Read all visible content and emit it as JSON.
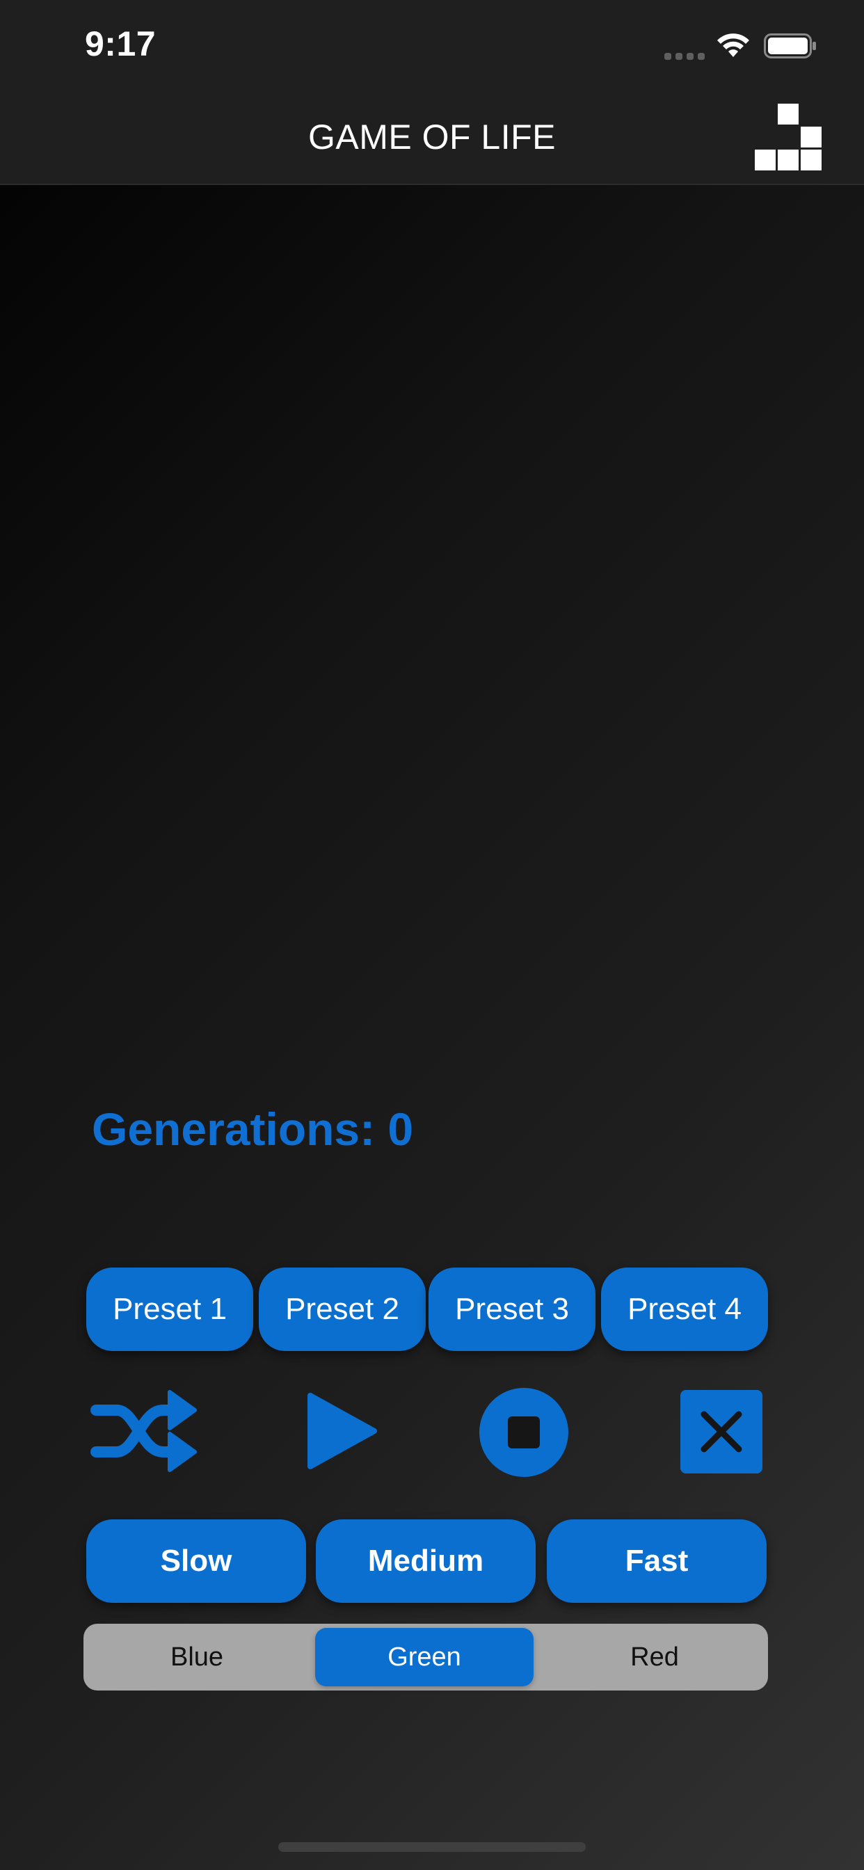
{
  "status_bar": {
    "time": "9:17",
    "signal_icon": "cellular-signal-icon",
    "wifi_icon": "wifi-icon",
    "battery_icon": "battery-icon"
  },
  "nav": {
    "title": "GAME OF LIFE",
    "logo_icon": "glider-pattern-icon"
  },
  "generations_label": "Generations: 0",
  "presets": [
    "Preset 1",
    "Preset 2",
    "Preset 3",
    "Preset 4"
  ],
  "controls": {
    "shuffle_icon": "shuffle-icon",
    "play_icon": "play-icon",
    "stop_icon": "stop-icon",
    "clear_icon": "clear-x-icon"
  },
  "speeds": [
    "Slow",
    "Medium",
    "Fast"
  ],
  "color_picker": {
    "options": [
      "Blue",
      "Green",
      "Red"
    ],
    "selected": "Green"
  },
  "colors": {
    "accent": "#0b6fcf",
    "title_blue": "#0f6fd2",
    "nav_background": "#1f1f1f",
    "segmented_background": "#a7a7a7"
  }
}
